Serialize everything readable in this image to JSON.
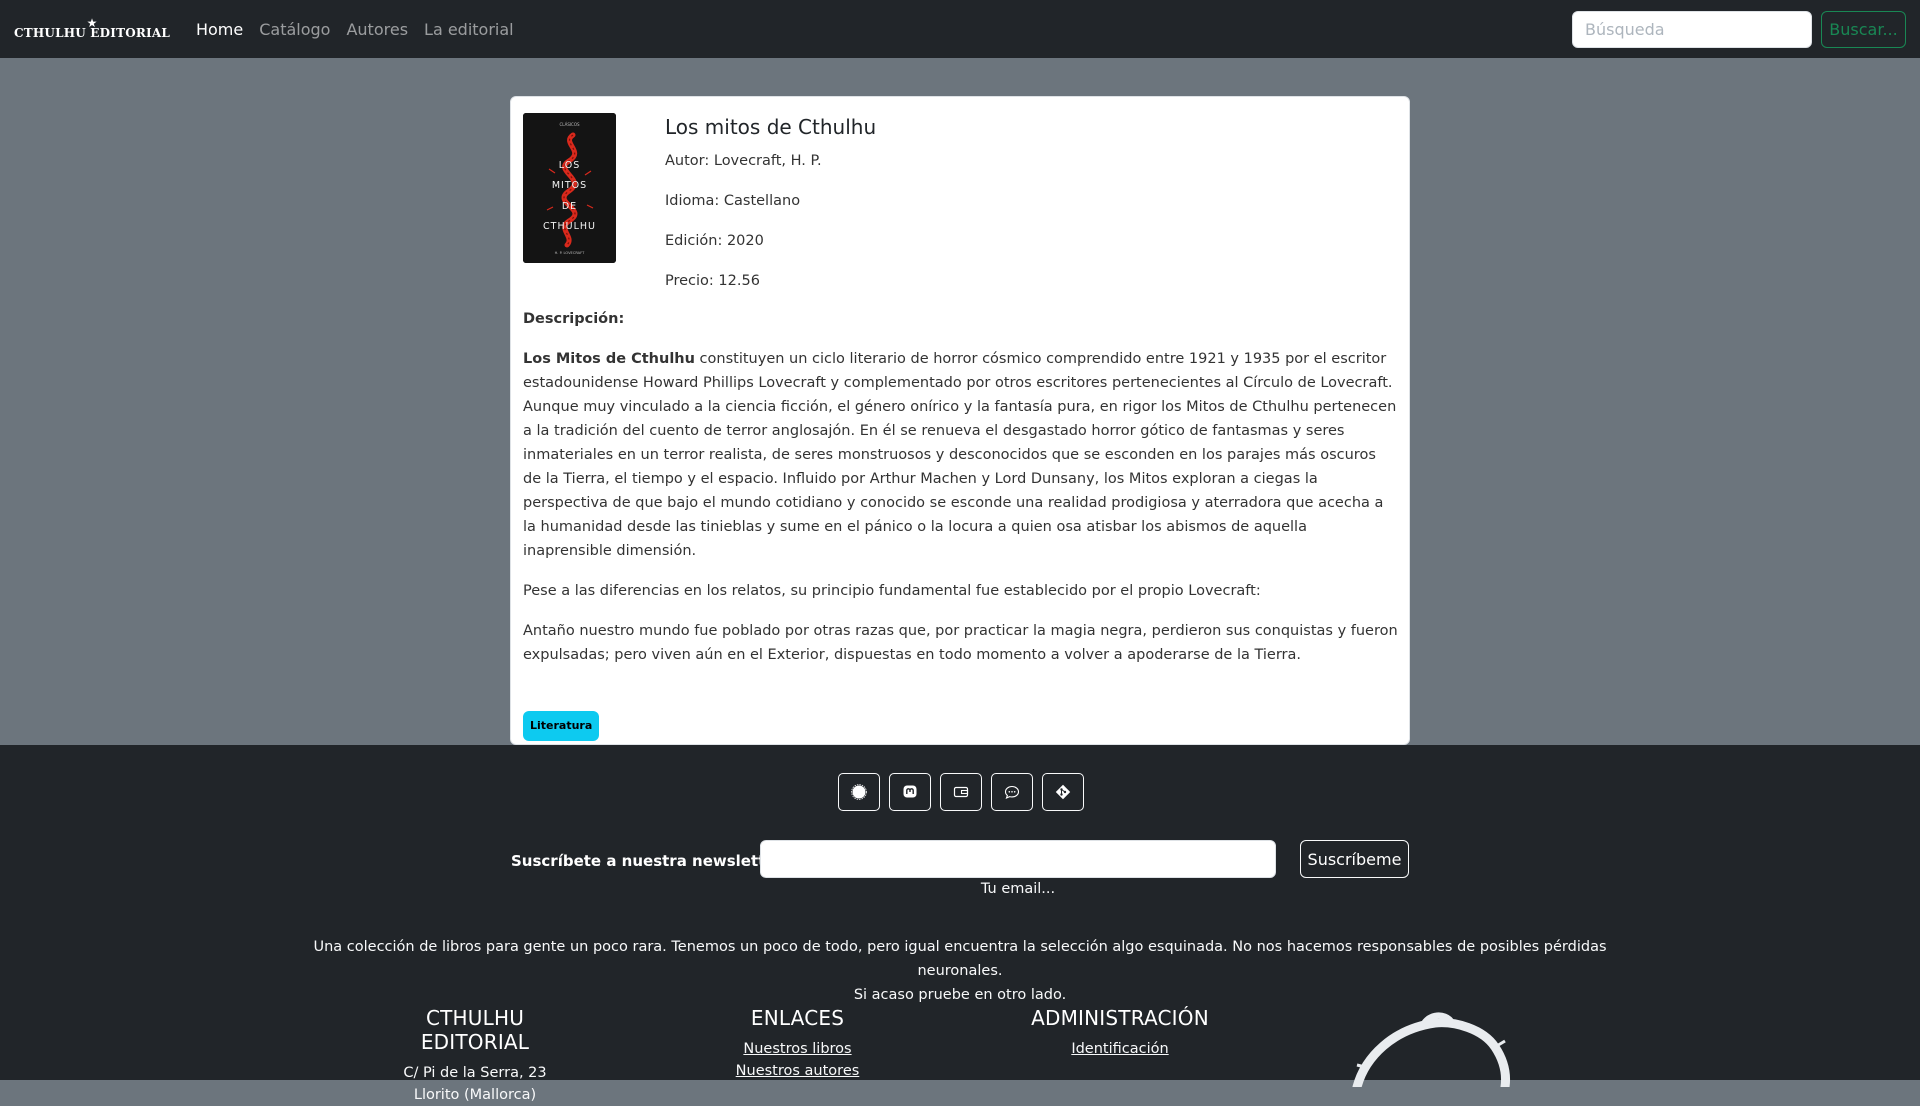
{
  "nav": {
    "brand": "CTHULHU EDITORIAL",
    "links": [
      "Home",
      "Catálogo",
      "Autores",
      "La editorial"
    ],
    "search_placeholder": "Búsqueda",
    "search_button": "Buscar..."
  },
  "book": {
    "title": "Los mitos de Cthulhu",
    "author": "Autor: Lovecraft, H. P.",
    "language": "Idioma: Castellano",
    "edition": "Edición: 2020",
    "price": "Precio: 12.56",
    "cover": {
      "top_text": "CLÁSICOS",
      "title_lines": [
        "LOS",
        "MITOS",
        "DE",
        "CTHULHU"
      ],
      "author": "H. P. LOVECRAFT"
    },
    "description_label": "Descripción:",
    "description_bold": "Los Mitos de Cthulhu",
    "description_p1": " constituyen un ciclo literario de horror cósmico comprendido entre 1921 y 1935 por el escritor estadounidense Howard Phillips Lovecraft y complementado por otros escritores pertenecientes al Círculo de Lovecraft. Aunque muy vinculado a la ciencia ficción, el género onírico y la fantasía pura, en rigor los Mitos de Cthulhu pertenecen a la tradición del cuento de terror anglosajón. En él se renueva el desgastado horror gótico de fantasmas y seres inmateriales en un terror realista, de seres monstruosos y desconocidos que se esconden en los parajes más oscuros de la Tierra, el tiempo y el espacio. Influido por Arthur Machen y Lord Dunsany, los Mitos exploran a ciegas la perspectiva de que bajo el mundo cotidiano y conocido se esconde una realidad prodigiosa y aterradora que acecha a la humanidad desde las tinieblas y sume en el pánico o la locura a quien osa atisbar los abismos de aquella inaprensible dimensión.",
    "description_p2": "Pese a las diferencias en los relatos, su principio fundamental fue establecido por el propio Lovecraft:",
    "description_p3": "Antaño nuestro mundo fue poblado por otras razas que, por practicar la magia negra, perdieron sus conquistas y fueron expulsadas; pero viven aún en el Exterior, dispuestas en todo momento a volver a apoderarse de la Tierra.",
    "tag": "Literatura"
  },
  "footer": {
    "social_icons": [
      "signal-icon",
      "mastodon-icon",
      "wallet-icon",
      "chat-icon",
      "git-icon"
    ],
    "newsletter_label": "Suscríbete a nuestra newsletter",
    "newsletter_hint": "Tu email...",
    "subscribe_button": "Suscríbeme",
    "about_line1": "Una colección de libros para gente un poco rara. Tenemos un poco de todo, pero igual encuentra la selección algo esquinada. No nos hacemos responsables de posibles pérdidas neuronales.",
    "about_line2": "Si acaso pruebe en otro lado.",
    "col1": {
      "heading": "CTHULHU EDITORIAL",
      "line1": "C/ Pi de la Serra, 23",
      "line2": "Llorito (Mallorca)"
    },
    "col2": {
      "heading": "ENLACES",
      "link1": "Nuestros libros",
      "link2": "Nuestros autores"
    },
    "col3": {
      "heading": "ADMINISTRACIÓN",
      "link1": "Identificación"
    }
  },
  "colors": {
    "navbar_bg": "#212529",
    "page_bg": "#6c757d",
    "search_button": "#198754",
    "badge": "#0dcaf0",
    "cover_red": "#d9291c"
  }
}
